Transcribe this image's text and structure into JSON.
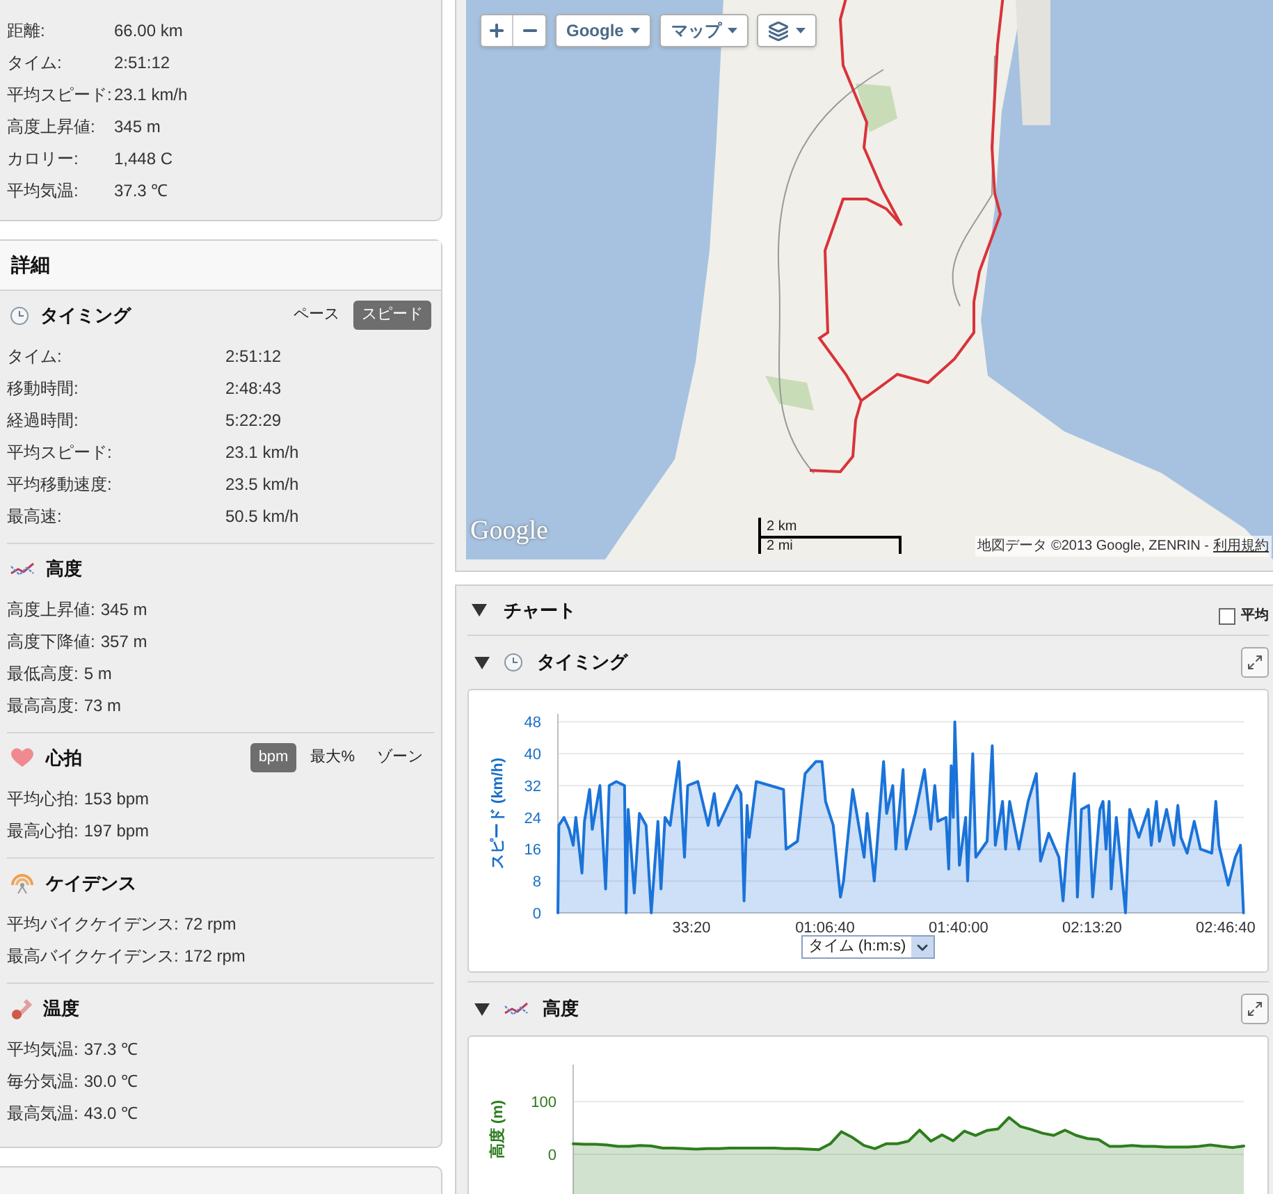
{
  "summary": {
    "rows": [
      {
        "label": "距離:",
        "value": "66.00 km"
      },
      {
        "label": "タイム:",
        "value": "2:51:12"
      },
      {
        "label": "平均スピード:",
        "value": "23.1 km/h"
      },
      {
        "label": "高度上昇値:",
        "value": "345 m"
      },
      {
        "label": "カロリー:",
        "value": "1,448 C"
      },
      {
        "label": "平均気温:",
        "value": "37.3 ℃"
      }
    ]
  },
  "details": {
    "title": "詳細",
    "sections": [
      {
        "kind": "timing",
        "title": "タイミング",
        "toggle": [
          {
            "label": "ペース",
            "selected": false
          },
          {
            "label": "スピード",
            "selected": true
          }
        ],
        "rows": [
          {
            "label": "タイム:",
            "value": "2:51:12"
          },
          {
            "label": "移動時間:",
            "value": "2:48:43"
          },
          {
            "label": "経過時間:",
            "value": "5:22:29"
          },
          {
            "label": "平均スピード:",
            "value": "23.1 km/h"
          },
          {
            "label": "平均移動速度:",
            "value": "23.5 km/h"
          },
          {
            "label": "最高速:",
            "value": "50.5 km/h"
          }
        ]
      },
      {
        "kind": "elevation",
        "title": "高度",
        "rows": [
          {
            "label": "高度上昇値:",
            "value": "345 m"
          },
          {
            "label": "高度下降値:",
            "value": "357 m"
          },
          {
            "label": "最低高度:",
            "value": "5 m"
          },
          {
            "label": "最高高度:",
            "value": "73 m"
          }
        ]
      },
      {
        "kind": "heart_rate",
        "title": "心拍",
        "toggle": [
          {
            "label": "bpm",
            "selected": true
          },
          {
            "label": "最大%",
            "selected": false
          },
          {
            "label": "ゾーン",
            "selected": false
          }
        ],
        "rows": [
          {
            "label": "平均心拍:",
            "value": "153 bpm"
          },
          {
            "label": "最高心拍:",
            "value": "197 bpm"
          }
        ]
      },
      {
        "kind": "cadence",
        "title": "ケイデンス",
        "rows": [
          {
            "label": "平均バイクケイデンス:",
            "value": "72 rpm"
          },
          {
            "label": "最高バイクケイデンス:",
            "value": "172 rpm"
          }
        ]
      },
      {
        "kind": "temperature",
        "title": "温度",
        "rows": [
          {
            "label": "平均気温:",
            "value": "37.3 ℃"
          },
          {
            "label": "毎分気温:",
            "value": "30.0 ℃"
          },
          {
            "label": "最高気温:",
            "value": "43.0 ℃"
          }
        ]
      }
    ]
  },
  "map": {
    "provider_menu": "Google",
    "type_menu": "マップ",
    "logo": "Google",
    "scale": [
      "2 km",
      "2 mi"
    ],
    "attribution": "地図データ ©2013 Google, ZENRIN -",
    "terms_link": "利用規約"
  },
  "charts_panel": {
    "title": "チャート",
    "average": {
      "label": "平均",
      "checked": false
    },
    "charts": [
      {
        "kind": "timing",
        "title": "タイミング",
        "chart_data": {
          "type": "area",
          "grid": true,
          "xlabel": "タイム (h:m:s)",
          "ylabel": "スピード (km/h)",
          "xlim": [
            0,
            10272
          ],
          "ylim": [
            0,
            50
          ],
          "xticks": [
            {
              "value": 2000,
              "label": "33:20"
            },
            {
              "value": 4000,
              "label": "01:06:40"
            },
            {
              "value": 6000,
              "label": "01:40:00"
            },
            {
              "value": 8000,
              "label": "02:13:20"
            },
            {
              "value": 10000,
              "label": "02:46:40"
            }
          ],
          "yticks": [
            0,
            8,
            16,
            24,
            32,
            40,
            48
          ],
          "x": [
            0,
            15,
            92,
            169,
            230,
            269,
            361,
            399,
            476,
            515,
            630,
            714,
            768,
            876,
            998,
            1021,
            1052,
            1144,
            1221,
            1321,
            1398,
            1498,
            1544,
            1605,
            1682,
            1743,
            1812,
            1897,
            1943,
            2097,
            2250,
            2342,
            2404,
            2680,
            2742,
            2788,
            2834,
            2865,
            2972,
            3180,
            3379,
            3418,
            3587,
            3702,
            3863,
            3955,
            4009,
            4124,
            4232,
            4278,
            4416,
            4585,
            4631,
            4739,
            4877,
            4923,
            5015,
            5061,
            5169,
            5215,
            5353,
            5491,
            5583,
            5645,
            5691,
            5814,
            5852,
            5891,
            5921,
            5944,
            6013,
            6106,
            6136,
            6213,
            6259,
            6428,
            6505,
            6551,
            6659,
            6705,
            6766,
            6904,
            7043,
            7165,
            7227,
            7350,
            7503,
            7565,
            7626,
            7734,
            7780,
            7841,
            7949,
            8010,
            8118,
            8164,
            8210,
            8256,
            8287,
            8364,
            8502,
            8563,
            8701,
            8840,
            8886,
            8963,
            9009,
            9116,
            9224,
            9285,
            9331,
            9423,
            9531,
            9623,
            9792,
            9853,
            9900,
            10038,
            10145,
            10222,
            10268
          ],
          "series": [
            {
              "color": "#1a73d9",
              "values": [
                0,
                22,
                24,
                21,
                17,
                24,
                10,
                23,
                31,
                21,
                32,
                6,
                32,
                33,
                32,
                0,
                26,
                5,
                25,
                22,
                0,
                23,
                6,
                24,
                22,
                30,
                38,
                14,
                32,
                33,
                22,
                30,
                22,
                32,
                30,
                3,
                27,
                19,
                33,
                32,
                31,
                16,
                18,
                35,
                38,
                38,
                28,
                22,
                4,
                8,
                31,
                14,
                25,
                8,
                38,
                25,
                32,
                16,
                36,
                16,
                25,
                36,
                21,
                32,
                23,
                24,
                11,
                37,
                24,
                48,
                12,
                24,
                8,
                40,
                14,
                18,
                42,
                17,
                28,
                16,
                28,
                16,
                28,
                35,
                13,
                20,
                14,
                3,
                17,
                35,
                4,
                26,
                27,
                4,
                26,
                28,
                16,
                28,
                6,
                24,
                0,
                26,
                19,
                26,
                17,
                28,
                18,
                26,
                17,
                27,
                19,
                15,
                23,
                16,
                15,
                28,
                17,
                7,
                14,
                17,
                0
              ]
            }
          ]
        }
      },
      {
        "kind": "elevation",
        "title": "高度",
        "chart_data": {
          "type": "area",
          "grid": true,
          "ylabel": "高度 (m)",
          "ylim": [
            -75,
            170
          ],
          "yticks": [
            0,
            100
          ],
          "series": [
            {
              "color": "#2e7d1e",
              "values": [
                20,
                19,
                19,
                18,
                15,
                15,
                17,
                16,
                12,
                12,
                11,
                10,
                11,
                11,
                12,
                12,
                12,
                12,
                12,
                11,
                11,
                10,
                9,
                20,
                43,
                32,
                17,
                11,
                20,
                20,
                25,
                46,
                25,
                37,
                26,
                44,
                36,
                45,
                48,
                70,
                53,
                47,
                40,
                36,
                46,
                36,
                30,
                28,
                15,
                15,
                17,
                15,
                15,
                14,
                14,
                14,
                15,
                18,
                15,
                13,
                16
              ]
            }
          ]
        }
      }
    ]
  }
}
